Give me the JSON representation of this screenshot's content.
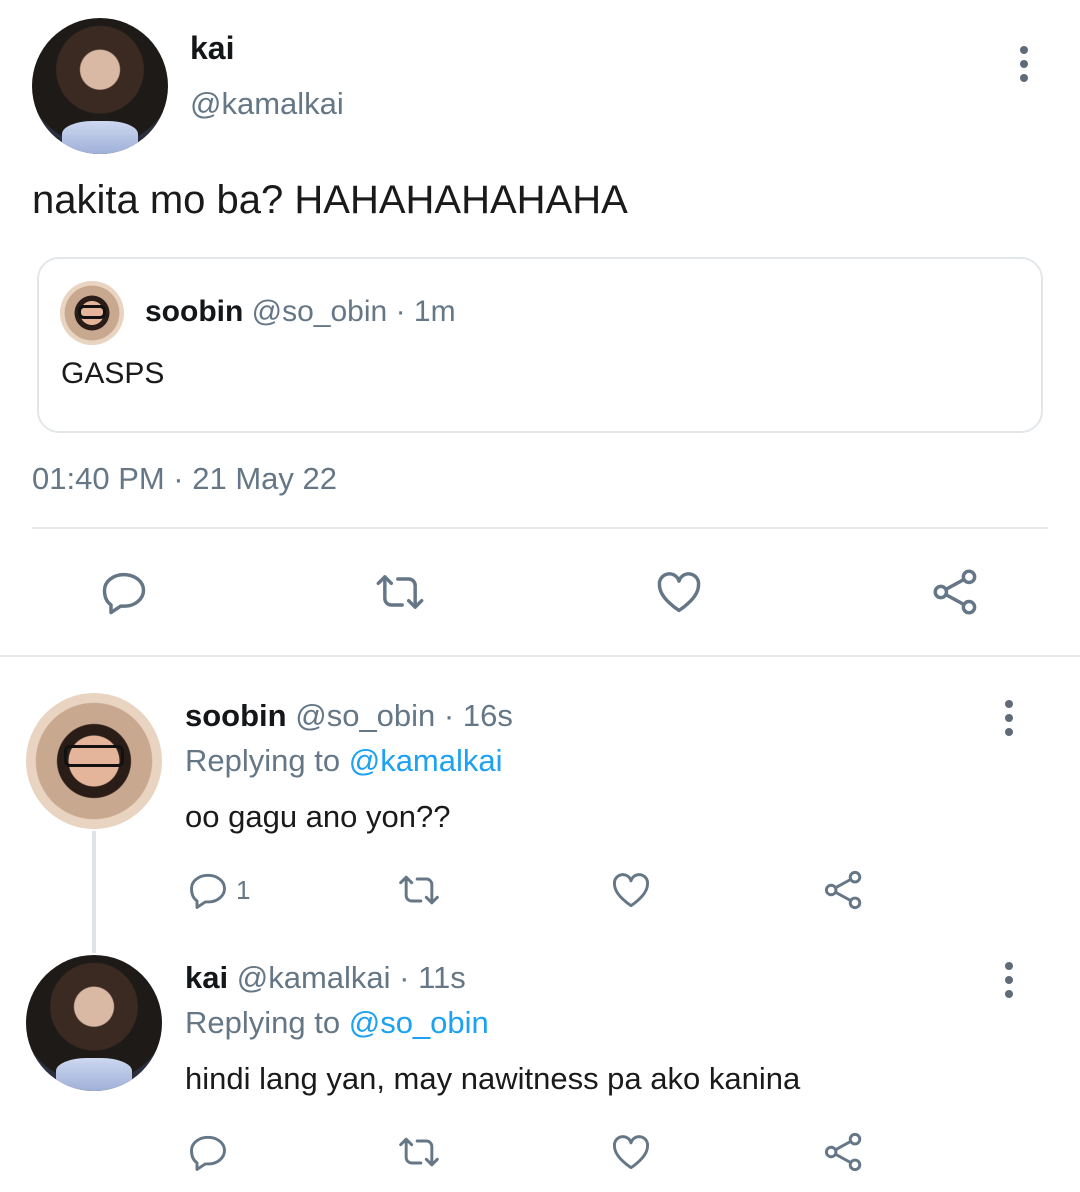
{
  "main_tweet": {
    "display_name": "kai",
    "handle": "@kamalkai",
    "text": "nakita mo ba? HAHAHAHAHAHA",
    "timestamp": "01:40 PM · 21 May 22",
    "quoted": {
      "display_name": "soobin",
      "handle": "@so_obin",
      "time": "· 1m",
      "text": "GASPS"
    }
  },
  "replies": [
    {
      "display_name": "soobin",
      "handle": "@so_obin",
      "time": "· 16s",
      "replying_label": "Replying to",
      "replying_to": "@kamalkai",
      "text": "oo gagu ano yon??",
      "reply_count": "1"
    },
    {
      "display_name": "kai",
      "handle": "@kamalkai",
      "time": "· 11s",
      "replying_label": "Replying to",
      "replying_to": "@so_obin",
      "text": "hindi lang yan, may nawitness pa ako kanina",
      "reply_count": ""
    }
  ],
  "icons": [
    "more-icon",
    "reply-icon",
    "retweet-icon",
    "like-icon",
    "share-icon"
  ],
  "colors": {
    "accent": "#1da1f2",
    "muted": "#657786",
    "divider": "#e8ebed"
  }
}
